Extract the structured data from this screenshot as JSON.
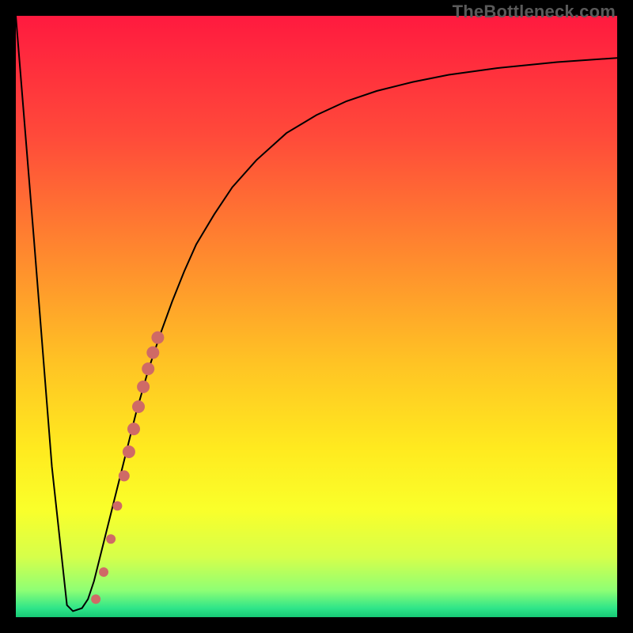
{
  "watermark": "TheBottleneck.com",
  "chart_data": {
    "type": "line",
    "title": "",
    "xlabel": "",
    "ylabel": "",
    "xlim": [
      0,
      100
    ],
    "ylim": [
      0,
      100
    ],
    "grid": false,
    "legend": false,
    "series": [
      {
        "name": "curve",
        "x": [
          0,
          3,
          6,
          8.5,
          9.5,
          11,
          12,
          13,
          14,
          15,
          16,
          18,
          20,
          22,
          24,
          26,
          28,
          30,
          33,
          36,
          40,
          45,
          50,
          55,
          60,
          66,
          72,
          80,
          90,
          100
        ],
        "y": [
          100,
          63,
          25,
          2,
          1,
          1.5,
          3,
          6,
          10,
          14,
          18,
          26,
          34,
          41,
          47,
          52.5,
          57.5,
          62,
          67,
          71.5,
          76,
          80.5,
          83.5,
          85.8,
          87.5,
          89,
          90.2,
          91.3,
          92.3,
          93
        ],
        "color": "#000000",
        "stroke_width": 2
      }
    ],
    "scatter": {
      "name": "highlight-points",
      "color": "#cf6a66",
      "points": [
        {
          "x": 13.3,
          "y": 3.0,
          "r": 6
        },
        {
          "x": 14.6,
          "y": 7.5,
          "r": 6
        },
        {
          "x": 15.8,
          "y": 13.0,
          "r": 6
        },
        {
          "x": 16.9,
          "y": 18.5,
          "r": 6
        },
        {
          "x": 18.0,
          "y": 23.5,
          "r": 7
        },
        {
          "x": 18.8,
          "y": 27.5,
          "r": 8
        },
        {
          "x": 19.6,
          "y": 31.3,
          "r": 8
        },
        {
          "x": 20.4,
          "y": 35.0,
          "r": 8
        },
        {
          "x": 21.2,
          "y": 38.3,
          "r": 8
        },
        {
          "x": 22.0,
          "y": 41.3,
          "r": 8
        },
        {
          "x": 22.8,
          "y": 44.0,
          "r": 8
        },
        {
          "x": 23.6,
          "y": 46.5,
          "r": 8
        }
      ]
    },
    "background_gradient": {
      "stops": [
        {
          "offset": 0.0,
          "color": "#ff1a3f"
        },
        {
          "offset": 0.2,
          "color": "#ff4a3a"
        },
        {
          "offset": 0.4,
          "color": "#ff8a2e"
        },
        {
          "offset": 0.58,
          "color": "#ffc424"
        },
        {
          "offset": 0.72,
          "color": "#ffea1f"
        },
        {
          "offset": 0.82,
          "color": "#faff2a"
        },
        {
          "offset": 0.9,
          "color": "#d6ff4a"
        },
        {
          "offset": 0.955,
          "color": "#8fff74"
        },
        {
          "offset": 0.985,
          "color": "#2fe589"
        },
        {
          "offset": 1.0,
          "color": "#17c975"
        }
      ]
    }
  }
}
